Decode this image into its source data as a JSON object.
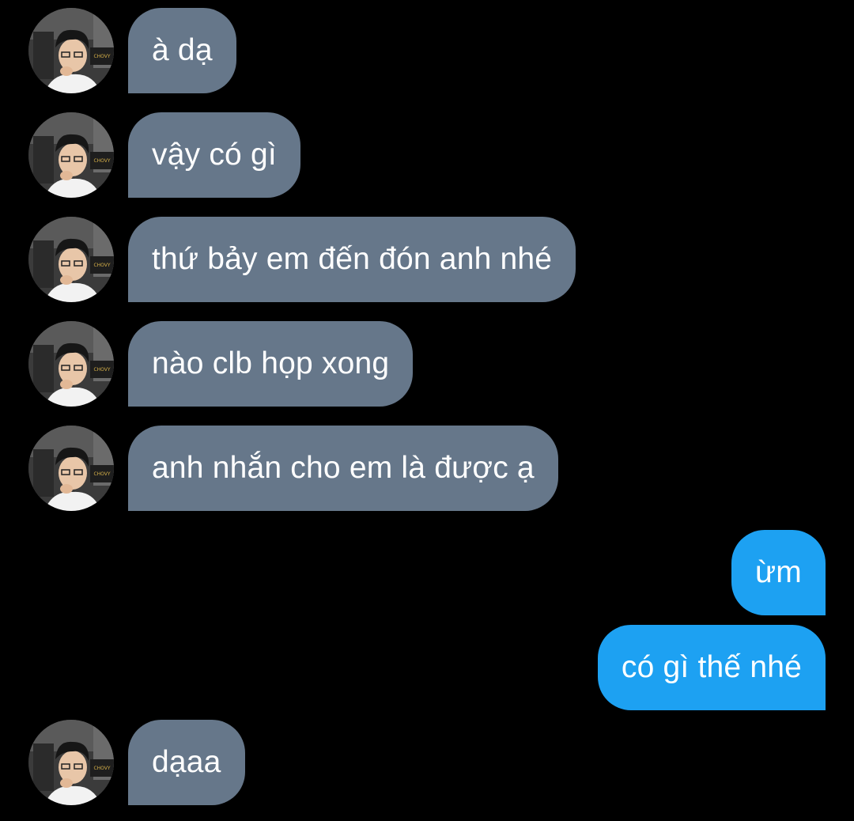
{
  "messages": [
    {
      "direction": "in",
      "text": "à dạ"
    },
    {
      "direction": "in",
      "text": "vậy có gì"
    },
    {
      "direction": "in",
      "text": "thứ bảy em đến đón anh nhé"
    },
    {
      "direction": "in",
      "text": "nào clb họp xong"
    },
    {
      "direction": "in",
      "text": "anh nhắn cho em là được ạ"
    },
    {
      "direction": "out",
      "text": "ừm"
    },
    {
      "direction": "out",
      "text": "có gì thế nhé"
    },
    {
      "direction": "in",
      "text": "dạaa"
    }
  ],
  "avatar_badge": "CHOVY",
  "colors": {
    "background": "#000000",
    "incoming_bubble": "#66778a",
    "outgoing_bubble": "#1da1f2",
    "text": "#ffffff"
  }
}
